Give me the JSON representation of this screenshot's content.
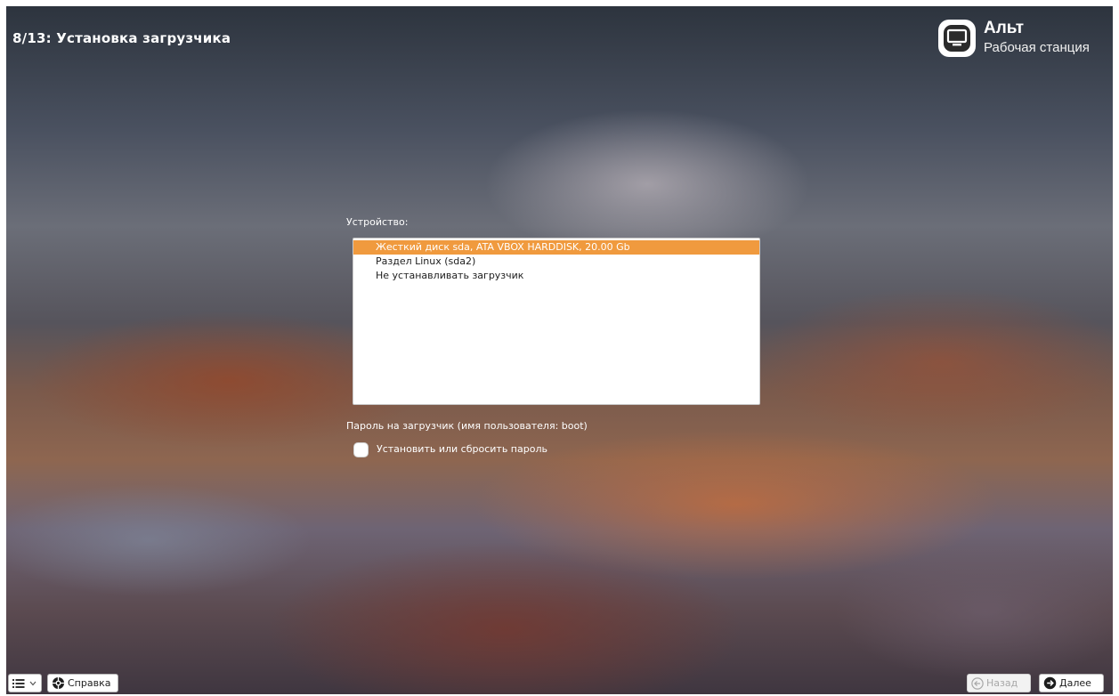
{
  "header": {
    "step_title": "8/13: Установка загрузчика"
  },
  "logo": {
    "name": "Альт",
    "subtitle": "Рабочая станция"
  },
  "device": {
    "label": "Устройство:",
    "items": [
      {
        "label": "Жесткий диск sda, ATA VBOX HARDDISK, 20.00 Gb",
        "selected": true
      },
      {
        "label": "Раздел Linux (sda2)",
        "selected": false
      },
      {
        "label": "Не устанавливать загрузчик",
        "selected": false
      }
    ]
  },
  "password": {
    "label": "Пароль на загрузчик (имя пользователя: boot)",
    "checkbox_label": "Установить или сбросить пароль",
    "checked": false
  },
  "footer": {
    "help_label": "Справка",
    "back_label": "Назад",
    "next_label": "Далее"
  },
  "colors": {
    "selection": "#f09a3e",
    "disabled_text": "#a8a8a8"
  }
}
